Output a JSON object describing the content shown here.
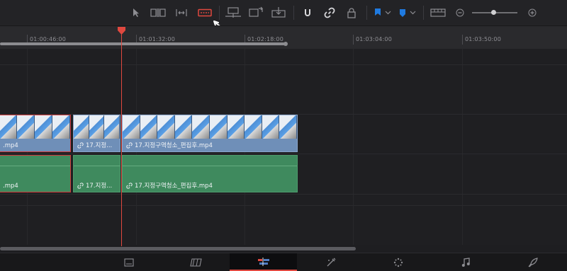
{
  "ruler": {
    "timecodes": [
      "01:00:46:00",
      "01:01:32:00",
      "01:02:18:00",
      "01:03:04:00",
      "01:03:50:00"
    ]
  },
  "clips": {
    "video": [
      {
        "label": ".mp4",
        "selected": true
      },
      {
        "label": "17.지정...",
        "selected": false
      },
      {
        "label": "17.지정구역청소_편집후.mp4",
        "selected": false
      }
    ],
    "audio": [
      {
        "label": ".mp4",
        "selected": true
      },
      {
        "label": "17.지정...",
        "selected": false
      },
      {
        "label": "17.지정구역청소_편집후.mp4",
        "selected": false
      }
    ]
  },
  "colors": {
    "video_clip": "#6f8fb8",
    "audio_clip": "#3f8a5e",
    "playhead": "#e0483f",
    "flag": "#1f7ae0",
    "active_tool": "#e0483f"
  },
  "toolbar": {
    "icons": [
      "select-arrow-icon",
      "trim-icon",
      "dynamic-trim-icon",
      "blade-icon",
      "insert-clip-icon",
      "overwrite-clip-icon",
      "replace-clip-icon",
      "snapping-icon",
      "link-icon",
      "lock-icon",
      "flag-icon",
      "marker-icon",
      "zoom-view-icon",
      "zoom-out-icon",
      "zoom-in-icon"
    ],
    "zoom_level": 0.45
  },
  "pages": [
    "media-page-icon",
    "cut-page-icon",
    "edit-page-icon",
    "fusion-page-icon",
    "color-page-icon",
    "fairlight-page-icon",
    "deliver-page-icon"
  ]
}
